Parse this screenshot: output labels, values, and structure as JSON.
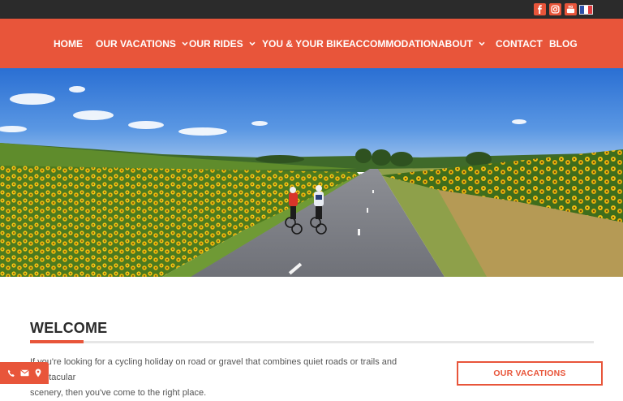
{
  "nav": {
    "items": [
      {
        "label": "HOME",
        "dropdown": false
      },
      {
        "label": "OUR VACATIONS",
        "dropdown": true
      },
      {
        "label": "OUR RIDES",
        "dropdown": true
      },
      {
        "label": "YOU & YOUR BIKE",
        "dropdown": false
      },
      {
        "label": "ACCOMMODATION",
        "dropdown": false
      },
      {
        "label": "ABOUT",
        "dropdown": true
      },
      {
        "label": "CONTACT",
        "dropdown": false
      },
      {
        "label": "BLOG",
        "dropdown": false
      }
    ]
  },
  "topbar": {
    "icons": [
      "facebook-icon",
      "instagram-icon",
      "youtube-icon",
      "french-flag-icon"
    ]
  },
  "welcome": {
    "heading": "WELCOME",
    "paragraph_line1": "If you're looking for a cycling holiday on road or gravel that combines quiet roads or trails and spectacular",
    "paragraph_line2": "scenery, then you've come to the right place."
  },
  "sidebar": {
    "vacations_button": "OUR VACATIONS"
  },
  "contact_tab": {
    "icons": [
      "phone-icon",
      "envelope-icon",
      "map-pin-icon"
    ]
  },
  "colors": {
    "accent": "#e8553a",
    "topbar": "#2b2b2b",
    "heading": "#2b2b2b",
    "body_text": "#555555"
  }
}
